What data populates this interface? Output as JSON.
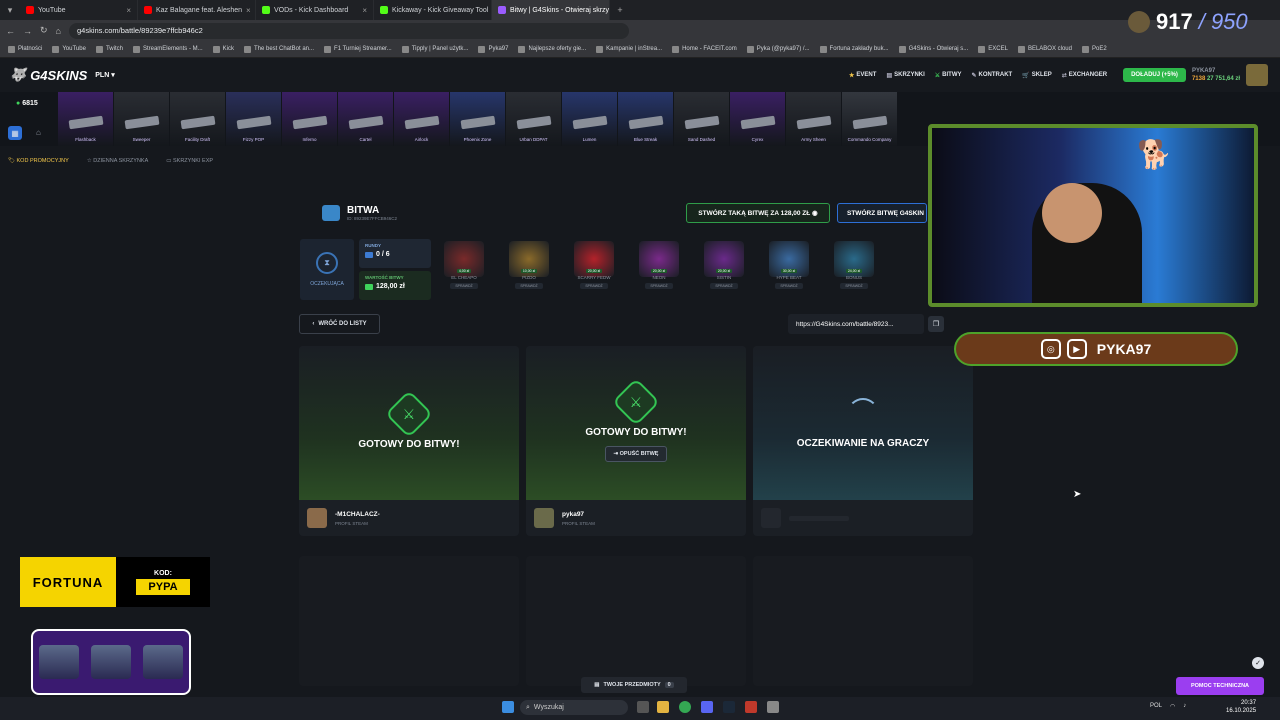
{
  "browser": {
    "tabs": [
      {
        "label": "YouTube",
        "color": "#ff0000"
      },
      {
        "label": "Kaz Balagane feat. Aleshen",
        "color": "#ff0000"
      },
      {
        "label": "VODs - Kick Dashboard",
        "color": "#53fc18"
      },
      {
        "label": "Kickaway - Kick Giveaway Tool",
        "color": "#53fc18"
      },
      {
        "label": "Bitwy | G4Skins - Otwieraj skrzy",
        "color": "#9b5cff"
      }
    ],
    "url": "g4skins.com/battle/89239e7ffcb946c2",
    "bookmarks": [
      "Płatności",
      "YouTube",
      "Twitch",
      "StreamElements - M...",
      "Kick",
      "The best ChatBot an...",
      "F1 Turniej Streamer...",
      "Tipply | Panel użytk...",
      "Pyka97",
      "Najlepsze oferty gie...",
      "Kampanie | inStrea...",
      "Home - FACEIT.com",
      "Pyka (@pyka97) /...",
      "Fortuna zakłady buk...",
      "G4Skins - Otwieraj s...",
      "EXCEL",
      "BELABOX cloud",
      "PoE2"
    ]
  },
  "header": {
    "logo": "G4SKINS",
    "currency": "PLN",
    "nav": [
      "EVENT",
      "SKRZYNKI",
      "BITWY",
      "KONTRAKT",
      "SKLEP",
      "EXCHANGER"
    ],
    "deposit": "DOŁADUJ (+5%)",
    "user": "PYKA97",
    "user_level": "7138",
    "balance": "27 751,64 zł"
  },
  "strip": {
    "online": "6815",
    "cases": [
      {
        "name": "Flashback",
        "color": "#3a1f63"
      },
      {
        "name": "Sweeper",
        "color": "#2a2d33"
      },
      {
        "name": "Facility Draft",
        "color": "#2a2d33"
      },
      {
        "name": "Fizzy POP",
        "color": "#2a2f5a"
      },
      {
        "name": "Inferno",
        "color": "#3a1f63"
      },
      {
        "name": "Cartel",
        "color": "#3a1f63"
      },
      {
        "name": "Airlock",
        "color": "#3a1f63"
      },
      {
        "name": "Phoenix Zone",
        "color": "#27366b"
      },
      {
        "name": "Urban DDPAT",
        "color": "#2a2d33"
      },
      {
        "name": "Lumen",
        "color": "#27366b"
      },
      {
        "name": "Blue Streak",
        "color": "#27366b"
      },
      {
        "name": "Sand Dashed",
        "color": "#2a2d33"
      },
      {
        "name": "Cyrex",
        "color": "#3a1f63"
      },
      {
        "name": "Army Sheen",
        "color": "#2a2d33"
      },
      {
        "name": "Commando Company",
        "color": "#33373e"
      }
    ]
  },
  "subnav": [
    "KOD PROMOCYJNY",
    "DZIENNA SKRZYNKA",
    "SKRZYNKI EXP"
  ],
  "battle": {
    "title": "BITWA",
    "id": "ID: 89239E7FFCB946C2",
    "create_same": "STWÓRZ TAKĄ BITWĘ ZA 128,00 ZŁ",
    "create_g4": "STWÓRZ BITWĘ G4SKIN",
    "status": "OCZEKUJĄCA",
    "rounds_label": "RUNDY",
    "rounds_value": "0 / 6",
    "value_label": "WARTOŚĆ BITWY",
    "value": "128,00 zł",
    "round_cases": [
      {
        "name": "EL CHEAPO",
        "price": "4,00 zł",
        "color": "#7a2a2a"
      },
      {
        "name": "PIZDO",
        "price": "10,00 zł",
        "color": "#8a6a2a"
      },
      {
        "name": "SCARRY FEDW",
        "price": "20,00 zł",
        "color": "#b3222a"
      },
      {
        "name": "NEON",
        "price": "20,00 zł",
        "color": "#7a2a8a"
      },
      {
        "name": "SISTIN",
        "price": "20,00 zł",
        "color": "#6a2a8a"
      },
      {
        "name": "HYPE BEAT",
        "price": "30,00 zł",
        "color": "#3a6aa0"
      },
      {
        "name": "BONUS",
        "price": "24,00 zł",
        "color": "#2a6a8a"
      }
    ],
    "check_label": "SPRAWDŹ",
    "back": "WRÓĆ DO LISTY",
    "link": "https://G4Skins.com/battle/8923..."
  },
  "players": [
    {
      "status": "GOTOWY DO BITWY!",
      "name": "-M1CHALACZ-",
      "sub": "PROFIL STEAM",
      "avatar": "#8a6a4a"
    },
    {
      "status": "GOTOWY DO BITWY!",
      "name": "pyka97",
      "sub": "PROFIL STEAM",
      "avatar": "#6a6a4a",
      "leave": "OPUŚĆ BITWĘ"
    },
    {
      "status": "OCZEKIWANIE NA GRACZY"
    }
  ],
  "overlay": {
    "count": "917",
    "goal": "/ 950",
    "social_name": "PYKA97",
    "fortuna": "FORTUNA",
    "kod": "KOD:",
    "code": "PYPA"
  },
  "footer": {
    "items": "TWOJE PRZEDMIOTY",
    "items_count": "0",
    "support": "POMOC TECHNICZNA"
  },
  "taskbar": {
    "search": "Wyszukaj",
    "lang": "POL",
    "time": "20:37",
    "date": "16.10.2025"
  }
}
